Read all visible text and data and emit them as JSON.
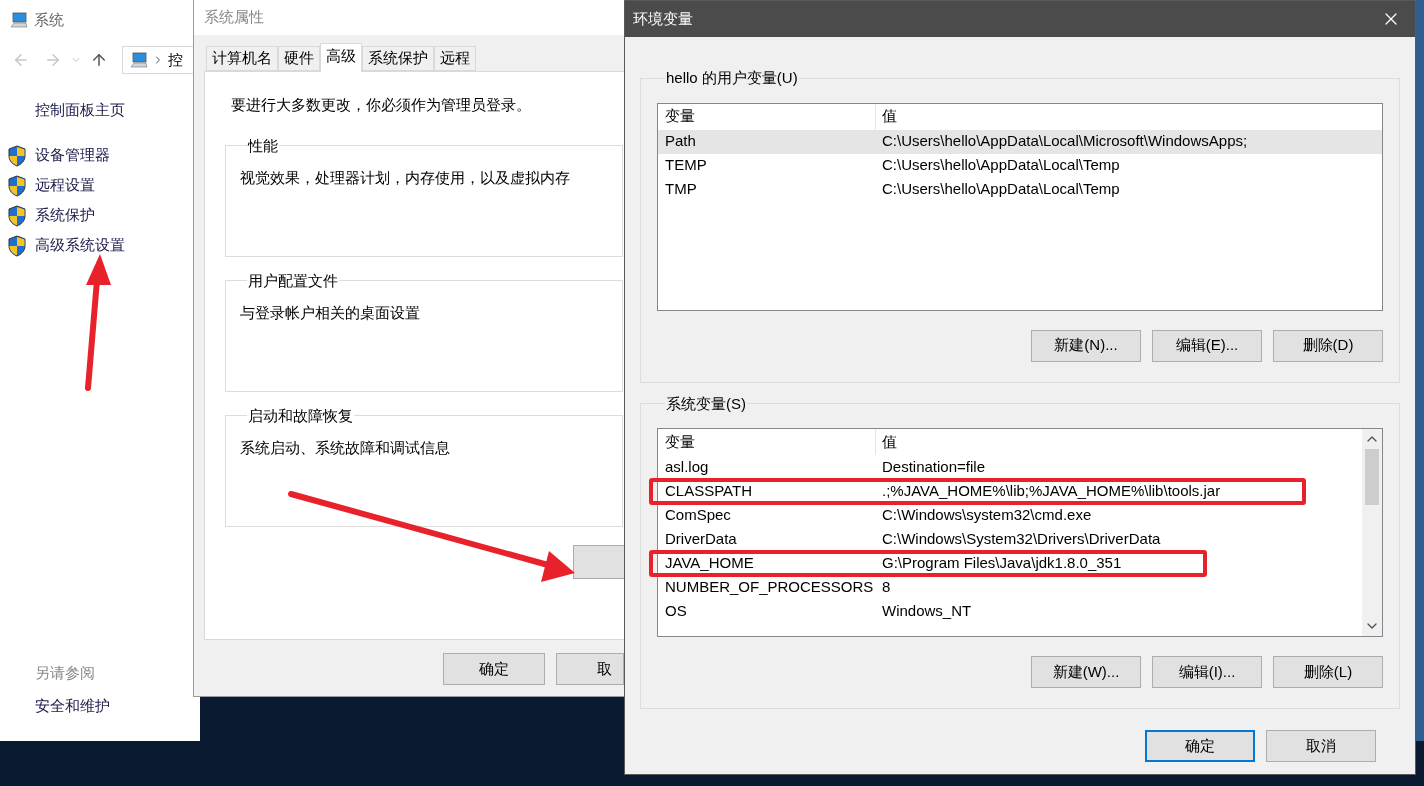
{
  "system_window": {
    "title": "系统",
    "address_crumb": "控",
    "home_link": "控制面板主页",
    "links": [
      "设备管理器",
      "远程设置",
      "系统保护",
      "高级系统设置"
    ],
    "see_also_heading": "另请参阅",
    "see_also_links": [
      "安全和维护"
    ]
  },
  "system_properties": {
    "title": "系统属性",
    "tabs": [
      {
        "label": "计算机名",
        "selected": false
      },
      {
        "label": "硬件",
        "selected": false
      },
      {
        "label": "高级",
        "selected": true
      },
      {
        "label": "系统保护",
        "selected": false
      },
      {
        "label": "远程",
        "selected": false
      }
    ],
    "admin_note": "要进行大多数更改，你必须作为管理员登录。",
    "groups": [
      {
        "title": "性能",
        "description": "视觉效果，处理器计划，内存使用，以及虚拟内存"
      },
      {
        "title": "用户配置文件",
        "description": "与登录帐户相关的桌面设置"
      },
      {
        "title": "启动和故障恢复",
        "description": "系统启动、系统故障和调试信息"
      }
    ],
    "buttons": [
      "确定",
      "取"
    ]
  },
  "environment_variables": {
    "title": "环境变量",
    "user_variables": {
      "heading": "hello 的用户变量(U)",
      "columns": [
        "变量",
        "值"
      ],
      "rows": [
        {
          "name": "Path",
          "value": "C:\\Users\\hello\\AppData\\Local\\Microsoft\\WindowsApps;",
          "selected": true
        },
        {
          "name": "TEMP",
          "value": "C:\\Users\\hello\\AppData\\Local\\Temp",
          "selected": false
        },
        {
          "name": "TMP",
          "value": "C:\\Users\\hello\\AppData\\Local\\Temp",
          "selected": false
        }
      ],
      "buttons": [
        "新建(N)...",
        "编辑(E)...",
        "删除(D)"
      ]
    },
    "system_variables": {
      "heading": "系统变量(S)",
      "columns": [
        "变量",
        "值"
      ],
      "rows": [
        {
          "name": "asl.log",
          "value": "Destination=file",
          "selected": false,
          "highlighted": false
        },
        {
          "name": "CLASSPATH",
          "value": ".;%JAVA_HOME%\\lib;%JAVA_HOME%\\lib\\tools.jar",
          "selected": false,
          "highlighted": true
        },
        {
          "name": "ComSpec",
          "value": "C:\\Windows\\system32\\cmd.exe",
          "selected": false,
          "highlighted": false
        },
        {
          "name": "DriverData",
          "value": "C:\\Windows\\System32\\Drivers\\DriverData",
          "selected": false,
          "highlighted": false
        },
        {
          "name": "JAVA_HOME",
          "value": "G:\\Program Files\\Java\\jdk1.8.0_351",
          "selected": false,
          "highlighted": true
        },
        {
          "name": "NUMBER_OF_PROCESSORS",
          "value": "8",
          "selected": false,
          "highlighted": false
        },
        {
          "name": "OS",
          "value": "Windows_NT",
          "selected": false,
          "highlighted": false
        }
      ],
      "buttons": [
        "新建(W)...",
        "编辑(I)...",
        "删除(L)"
      ]
    },
    "buttons": [
      {
        "label": "确定",
        "focused": true
      },
      {
        "label": "取消",
        "focused": false
      }
    ]
  }
}
